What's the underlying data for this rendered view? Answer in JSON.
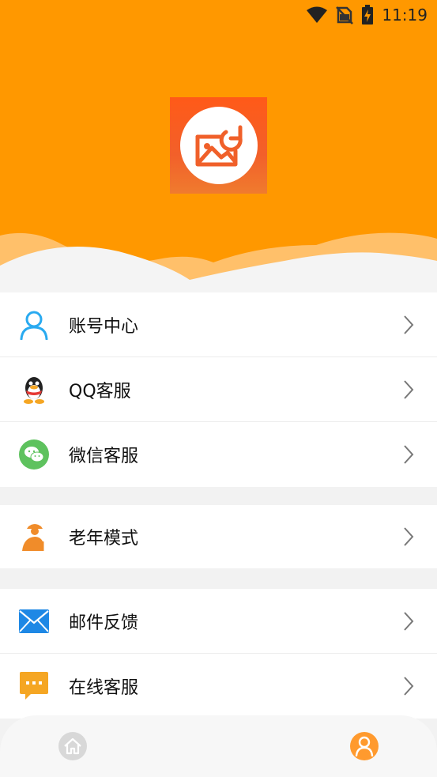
{
  "status_bar": {
    "time": "11:19",
    "icons": [
      "wifi-icon",
      "no-sim-icon",
      "battery-charging-icon"
    ]
  },
  "header": {
    "logo": "photo-restore-app-logo",
    "accent_color": "#ff9800"
  },
  "menu_groups": [
    {
      "items": [
        {
          "label": "账号中心",
          "icon": "user-icon"
        },
        {
          "label": "QQ客服",
          "icon": "qq-icon"
        },
        {
          "label": "微信客服",
          "icon": "wechat-icon"
        }
      ]
    },
    {
      "items": [
        {
          "label": "老年模式",
          "icon": "elder-icon"
        }
      ]
    },
    {
      "items": [
        {
          "label": "邮件反馈",
          "icon": "mail-icon"
        },
        {
          "label": "在线客服",
          "icon": "chat-icon"
        }
      ]
    }
  ],
  "bottom_nav": {
    "items": [
      {
        "icon": "home-icon",
        "active": false
      },
      {
        "icon": "profile-icon",
        "active": true
      }
    ]
  }
}
